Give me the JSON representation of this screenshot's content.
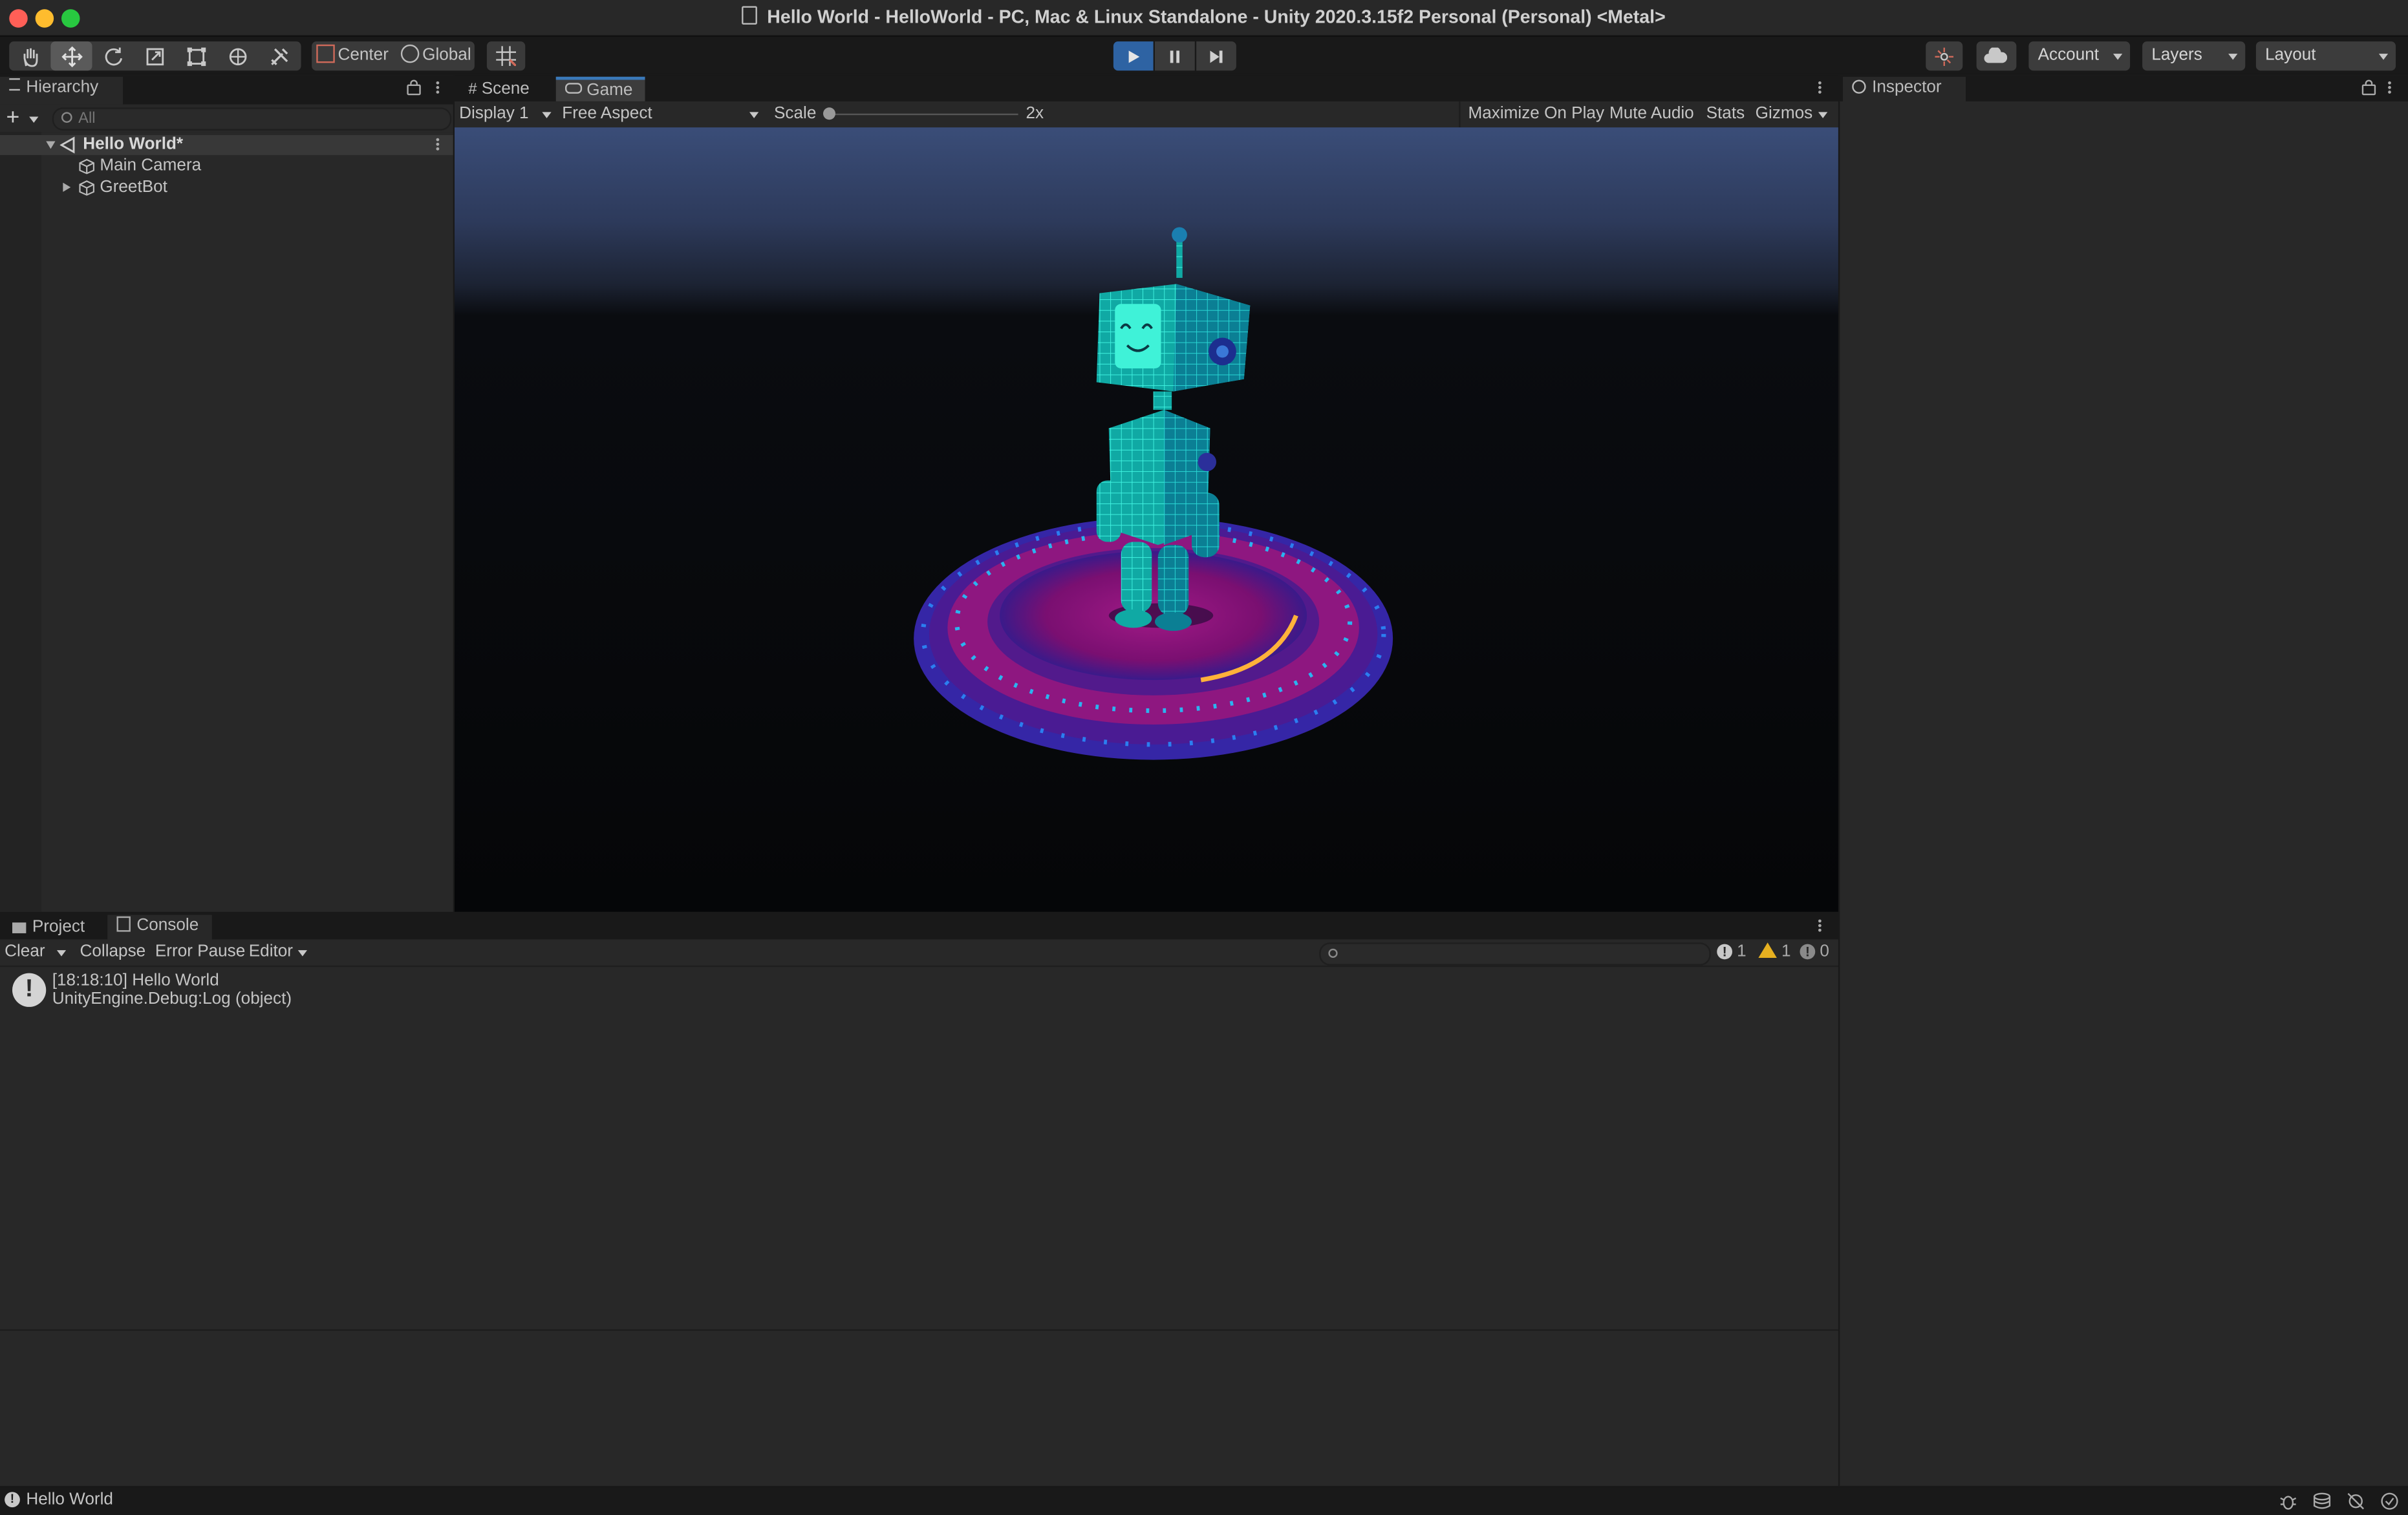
{
  "window": {
    "title": "Hello World - HelloWorld - PC, Mac & Linux Standalone - Unity 2020.3.15f2 Personal (Personal) <Metal>"
  },
  "toolbar": {
    "tools": [
      "hand-tool-icon",
      "move-tool-icon",
      "rotate-tool-icon",
      "scale-tool-icon",
      "rect-tool-icon",
      "transform-tool-icon",
      "custom-tool-icon"
    ],
    "pivot_label": "Center",
    "space_label": "Global",
    "account_label": "Account",
    "layers_label": "Layers",
    "layout_label": "Layout"
  },
  "hierarchy": {
    "tab_label": "Hierarchy",
    "search_placeholder": "All",
    "scene_name": "Hello World*",
    "items": [
      {
        "label": "Main Camera"
      },
      {
        "label": "GreetBot"
      }
    ]
  },
  "game_view": {
    "tabs": [
      {
        "label": "Scene"
      },
      {
        "label": "Game"
      }
    ],
    "display_label": "Display 1",
    "aspect_label": "Free Aspect",
    "scale_label": "Scale",
    "scale_value": "2x",
    "maximize_label": "Maximize On Play",
    "mute_label": "Mute Audio",
    "stats_label": "Stats",
    "gizmos_label": "Gizmos"
  },
  "inspector": {
    "tab_label": "Inspector"
  },
  "bottom_panel": {
    "tabs": [
      {
        "label": "Project"
      },
      {
        "label": "Console"
      }
    ],
    "clear_label": "Clear",
    "collapse_label": "Collapse",
    "error_pause_label": "Error Pause",
    "editor_label": "Editor",
    "counts": {
      "info": "1",
      "warning": "1",
      "error": "0"
    },
    "log": {
      "line1": "[18:18:10] Hello World",
      "line2": "UnityEngine.Debug:Log (object)"
    }
  },
  "status_bar": {
    "message": "Hello World"
  },
  "colors": {
    "accent": "#2e63a3",
    "tab_highlight": "#3a79bb",
    "panel_bg": "#282828",
    "robot": "#1fd6c8",
    "platform": "#a0187f"
  }
}
